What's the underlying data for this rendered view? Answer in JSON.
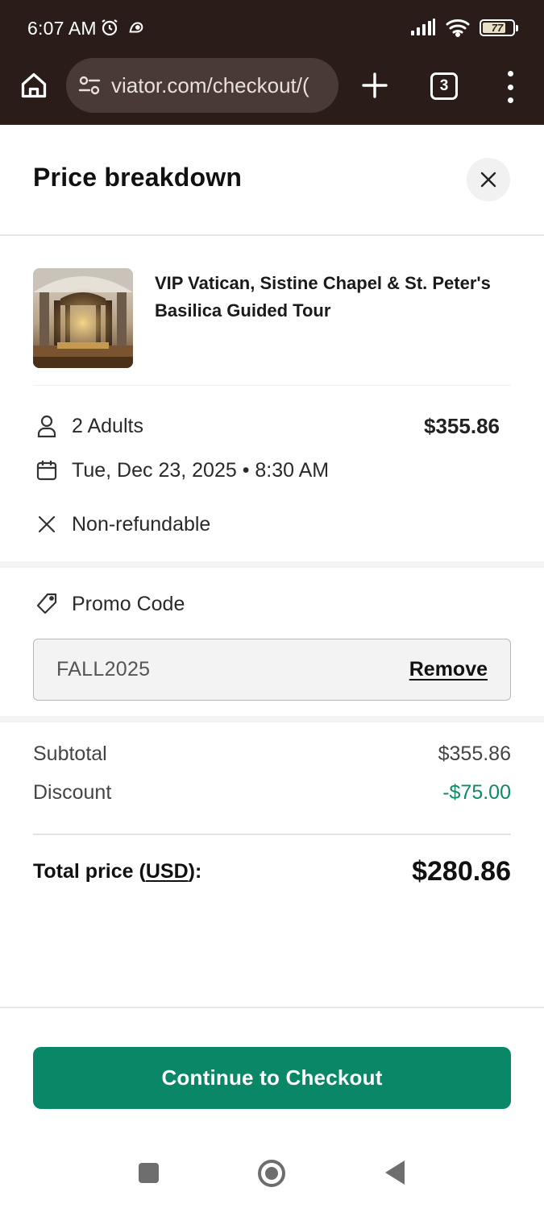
{
  "status_bar": {
    "time": "6:07 AM",
    "battery": "77",
    "battery_level": 0.77
  },
  "browser": {
    "url": "viator.com/checkout/(",
    "tab_count": "3"
  },
  "sheet": {
    "title": "Price breakdown"
  },
  "product": {
    "title": "VIP Vatican, Sistine Chapel & St. Peter's Basilica Guided Tour"
  },
  "details": {
    "travelers": "2 Adults",
    "travelers_price": "$355.86",
    "date": "Tue, Dec 23, 2025 • 8:30 AM",
    "refund_policy": "Non-refundable"
  },
  "promo": {
    "label": "Promo Code",
    "value": "FALL2025",
    "remove_label": "Remove"
  },
  "totals": {
    "subtotal_label": "Subtotal",
    "subtotal_value": "$355.86",
    "discount_label": "Discount",
    "discount_value": "-$75.00",
    "total_label_prefix": "Total price (",
    "total_currency": "USD",
    "total_label_suffix": "):",
    "total_value": "$280.86"
  },
  "cta": {
    "checkout_label": "Continue to Checkout"
  },
  "colors": {
    "brand_green": "#0a8766",
    "discount_green": "#0f8a65",
    "chrome_bg": "#2a1d19"
  }
}
